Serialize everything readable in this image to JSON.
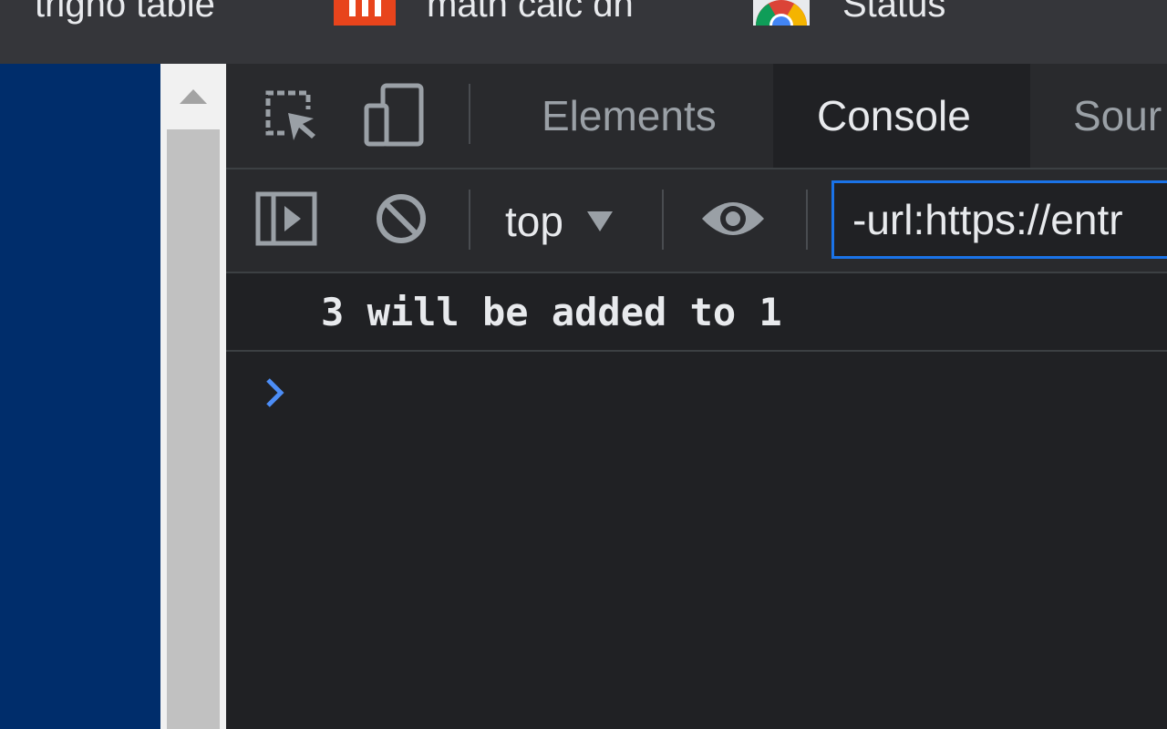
{
  "bookmarks_bar": {
    "items": [
      {
        "label": "trigno table"
      },
      {
        "label": "math calc dn"
      },
      {
        "label": "Status"
      }
    ]
  },
  "devtools": {
    "tabs": [
      {
        "label": "Elements"
      },
      {
        "label": "Console",
        "active": true
      },
      {
        "label": "Sour"
      }
    ],
    "console_toolbar": {
      "context_value": "top",
      "filter_value": "-url:https://entr"
    },
    "console": {
      "messages": [
        {
          "text": "3 will be added to 1"
        }
      ]
    },
    "colors": {
      "accent": "#1a73e8",
      "prompt": "#4c8df6",
      "panel_bg": "#202124",
      "toolbar_bg": "#292a2d"
    }
  },
  "icons": [
    "inspect-element-icon",
    "device-toolbar-icon",
    "sidebar-toggle-icon",
    "clear-console-icon",
    "live-expression-eye-icon",
    "scroll-up-arrow-icon",
    "console-prompt-chevron-icon"
  ]
}
